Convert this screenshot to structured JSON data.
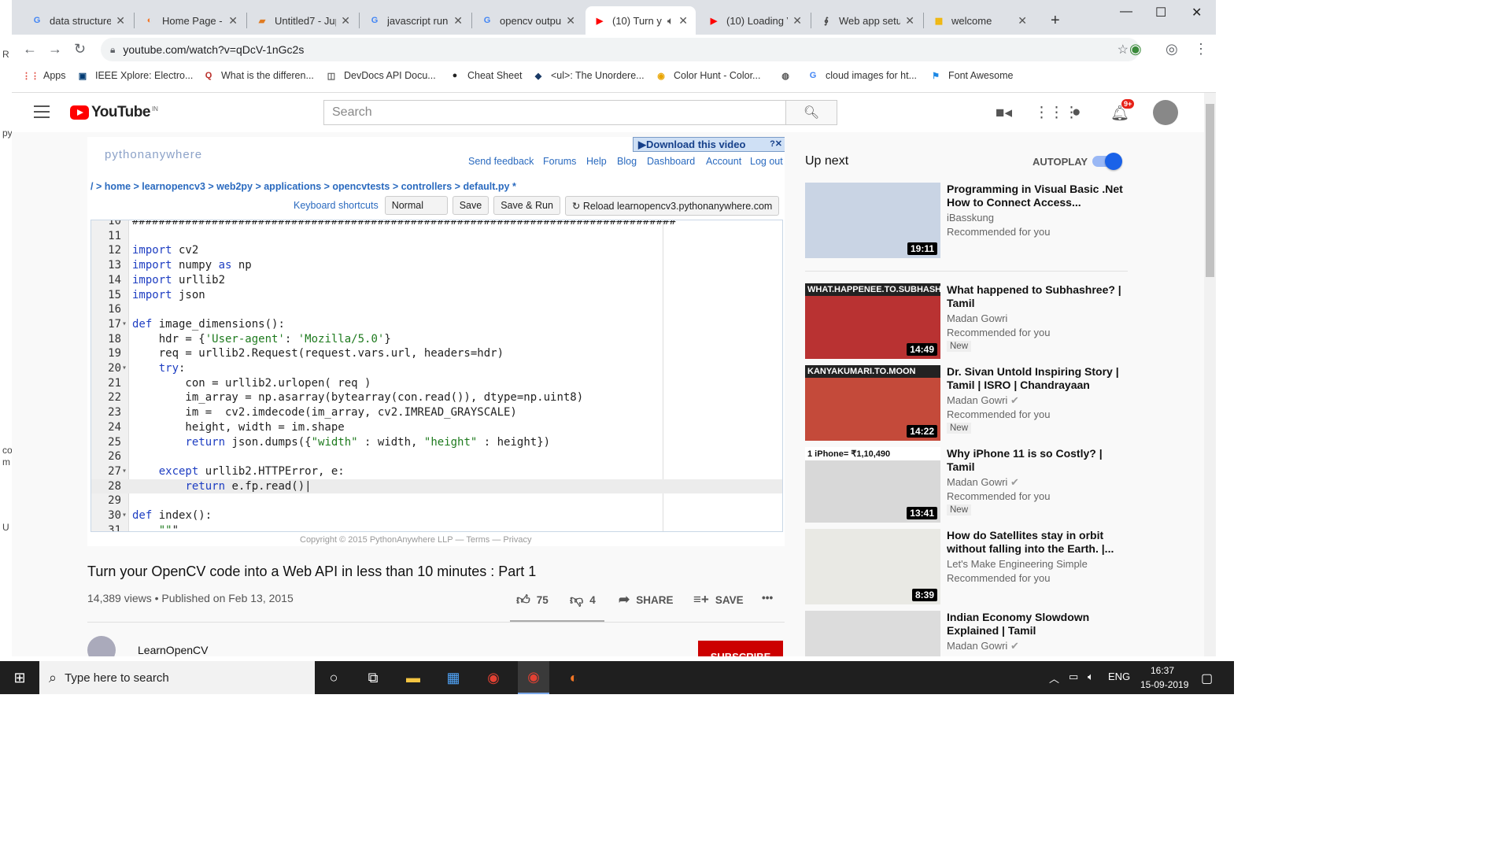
{
  "left_strip": [
    "R",
    "py",
    "co",
    "m",
    "U"
  ],
  "browser": {
    "tabs": [
      {
        "title": "data structure",
        "fav": "G",
        "color": "#4285f4"
      },
      {
        "title": "Home Page - S",
        "fav": "◐",
        "color": "#f37626"
      },
      {
        "title": "Untitled7 - Jup",
        "fav": "▰",
        "color": "#e07b22"
      },
      {
        "title": "javascript run",
        "fav": "G",
        "color": "#4285f4"
      },
      {
        "title": "opencv outpu",
        "fav": "G",
        "color": "#4285f4"
      },
      {
        "title": "(10) Turn y",
        "fav": "▶",
        "color": "#ff0000",
        "active": true
      },
      {
        "title": "(10) Loading V",
        "fav": "▶",
        "color": "#ff0000"
      },
      {
        "title": "Web app setu",
        "fav": "∮",
        "color": "#444"
      },
      {
        "title": "welcome",
        "fav": "▦",
        "color": "#f0b400"
      }
    ],
    "new_tab": "+",
    "url": "youtube.com/watch?v=qDcV-1nGc2s",
    "bookmarks": [
      {
        "label": "Apps",
        "icon": "⋮⋮",
        "color": "#e04a3f"
      },
      {
        "label": "IEEE Xplore: Electro...",
        "icon": "▣",
        "color": "#003b73"
      },
      {
        "label": "What is the differen...",
        "icon": "Q",
        "color": "#b92b27"
      },
      {
        "label": "DevDocs API Docu...",
        "icon": "◫",
        "color": "#555"
      },
      {
        "label": "Cheat Sheet",
        "icon": "●",
        "color": "#222"
      },
      {
        "label": "<ul>: The Unordere...",
        "icon": "◆",
        "color": "#1a3a66"
      },
      {
        "label": "Color Hunt - Color...",
        "icon": "◉",
        "color": "#e8a400"
      },
      {
        "label": "",
        "icon": "◍",
        "color": "#555"
      },
      {
        "label": "cloud images for ht...",
        "icon": "G",
        "color": "#4285f4"
      },
      {
        "label": "Font Awesome",
        "icon": "⚑",
        "color": "#1c88e5"
      }
    ]
  },
  "youtube": {
    "logo": "YouTube",
    "country": "IN",
    "search_placeholder": "Search",
    "notifications": "9+",
    "video_frame": {
      "download": "▶Download this video",
      "download_help": "?✕",
      "pa_logo": "pythonanywhere",
      "pa_nav": [
        "Send feedback",
        "Forums",
        "Help",
        "Blog",
        "Dashboard",
        "Account",
        "Log out"
      ],
      "breadcrumb": "/ > home > learnopencv3 > web2py > applications > opencvtests > controllers > default.py *",
      "keyboard_shortcuts": "Keyboard shortcuts",
      "mode": "Normal",
      "save": "Save",
      "save_run": "Save & Run",
      "reload": "Reload learnopencv3.pythonanywhere.com",
      "copyright": "Copyright © 2015 PythonAnywhere LLP — Terms — Privacy",
      "code_lines": [
        {
          "n": "10",
          "code": "##################################################################################"
        },
        {
          "n": "11",
          "code": ""
        },
        {
          "n": "12",
          "code": "import cv2"
        },
        {
          "n": "13",
          "code": "import numpy as np"
        },
        {
          "n": "14",
          "code": "import urllib2"
        },
        {
          "n": "15",
          "code": "import json"
        },
        {
          "n": "16",
          "code": ""
        },
        {
          "n": "17",
          "code": "def image_dimensions():",
          "fold": true
        },
        {
          "n": "18",
          "code": "    hdr = {'User-agent': 'Mozilla/5.0'}"
        },
        {
          "n": "19",
          "code": "    req = urllib2.Request(request.vars.url, headers=hdr)"
        },
        {
          "n": "20",
          "code": "    try:",
          "fold": true
        },
        {
          "n": "21",
          "code": "        con = urllib2.urlopen( req )"
        },
        {
          "n": "22",
          "code": "        im_array = np.asarray(bytearray(con.read()), dtype=np.uint8)"
        },
        {
          "n": "23",
          "code": "        im =  cv2.imdecode(im_array, cv2.IMREAD_GRAYSCALE)"
        },
        {
          "n": "24",
          "code": "        height, width = im.shape"
        },
        {
          "n": "25",
          "code": "        return json.dumps({\"width\" : width, \"height\" : height})"
        },
        {
          "n": "26",
          "code": ""
        },
        {
          "n": "27",
          "code": "    except urllib2.HTTPError, e:",
          "fold": true
        },
        {
          "n": "28",
          "code": "        return e.fp.read()|",
          "active": true
        },
        {
          "n": "29",
          "code": ""
        },
        {
          "n": "30",
          "code": "def index():",
          "fold": true
        },
        {
          "n": "31",
          "code": "    \"\"\""
        }
      ]
    },
    "video": {
      "title": "Turn your OpenCV code into a Web API in less than 10 minutes : Part 1",
      "meta": "14,389 views • Published on Feb 13, 2015",
      "likes": "75",
      "dislikes": "4",
      "share": "SHARE",
      "save": "SAVE",
      "more": "•••",
      "channel": "LearnOpenCV",
      "subscribe": "SUBSCRIBE"
    },
    "sidebar": {
      "up_next": "Up next",
      "autoplay": "AUTOPLAY",
      "autoplay_on": true,
      "items": [
        {
          "title": "Programming in Visual Basic .Net How to Connect Access...",
          "channel": "iBasskung",
          "verified": false,
          "meta": "Recommended for you",
          "duration": "19:11",
          "new": "",
          "thumb": "#c9d4e4",
          "thumb_text": ""
        },
        {
          "title": "What happened to Subhashree? | Tamil",
          "channel": "Madan Gowri",
          "verified": false,
          "meta": "Recommended for you",
          "duration": "14:49",
          "new": "New",
          "thumb": "#b93232",
          "thumb_text": "WHAT.HAPPENEE.TO.SUBHASHREE?"
        },
        {
          "title": "Dr. Sivan Untold Inspiring Story | Tamil | ISRO | Chandrayaan",
          "channel": "Madan Gowri",
          "verified": true,
          "meta": "Recommended for you",
          "duration": "14:22",
          "new": "New",
          "thumb": "#c44a3a",
          "thumb_text": "KANYAKUMARI.TO.MOON"
        },
        {
          "title": "Why iPhone 11 is so Costly? | Tamil",
          "channel": "Madan Gowri",
          "verified": true,
          "meta": "Recommended for you",
          "duration": "13:41",
          "new": "New",
          "thumb": "#d8d8d8",
          "thumb_text": "1 iPhone= ₹1,10,490"
        },
        {
          "title": "How do Satellites stay in orbit without falling into the Earth. |...",
          "channel": "Let's Make Engineering Simple",
          "verified": false,
          "meta": "Recommended for you",
          "duration": "8:39",
          "new": "",
          "thumb": "#e9e9e4",
          "thumb_text": ""
        },
        {
          "title": "Indian Economy Slowdown Explained | Tamil",
          "channel": "Madan Gowri",
          "verified": true,
          "meta": "",
          "duration": "",
          "new": "",
          "thumb": "#dcdcdc",
          "thumb_text": ""
        }
      ]
    }
  },
  "taskbar": {
    "search_placeholder": "Type here to search",
    "lang": "ENG",
    "time": "16:37",
    "date": "15-09-2019"
  }
}
